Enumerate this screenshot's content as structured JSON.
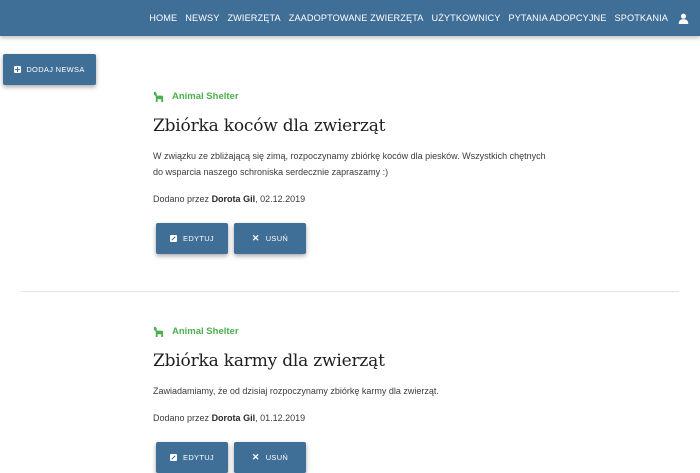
{
  "nav": {
    "items": [
      "HOME",
      "NEWSY",
      "ZWIERZĘTA",
      "ZAADOPTOWANE ZWIERZĘTA",
      "UŻYTKOWNICY",
      "PYTANIA ADOPCYJNE",
      "SPOTKANIA"
    ],
    "user_icon": "user-icon"
  },
  "toolbar": {
    "add_news_label": "DODAJ NEWSA"
  },
  "posts": [
    {
      "source": "Animal Shelter",
      "title": "Zbiórka koców dla zwierząt",
      "body": "W związku ze zbliżającą się zimą, rozpoczynamy zbiórkę koców dla piesków. Wszystkich chętnych do wsparcia naszego schroniska serdecznie zapraszamy :)",
      "added_by_prefix": "Dodano przez",
      "author": "Dorota Gil",
      "date": ", 02.12.2019",
      "edit_label": "EDYTUJ",
      "delete_label": "USUŃ"
    },
    {
      "source": "Animal Shelter",
      "title": "Zbiórka karmy dla zwierząt",
      "body": "Zawiadamiamy, że od dzisiaj rozpoczynamy zbiórkę karmy dla zwierząt.",
      "added_by_prefix": "Dodano przez",
      "author": "Dorota Gil",
      "date": ", 01.12.2019",
      "edit_label": "EDYTUJ",
      "delete_label": "USUŃ"
    }
  ],
  "colors": {
    "primary": "#3f6e97",
    "accent_green": "#4caf50"
  }
}
